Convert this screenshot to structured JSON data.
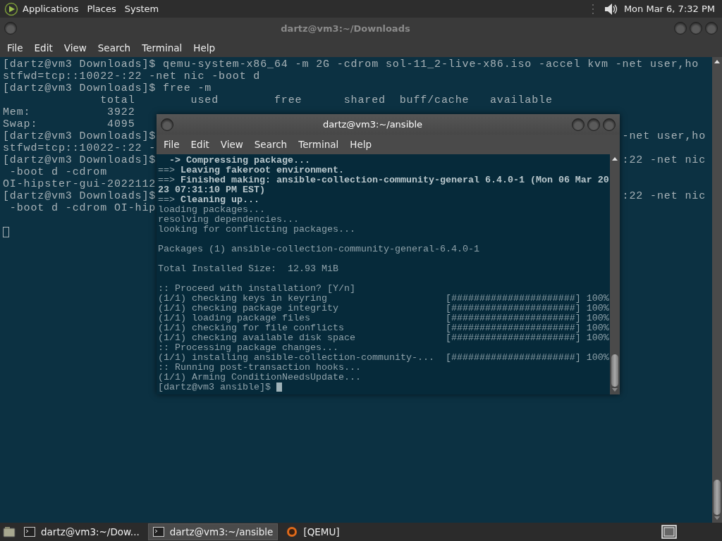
{
  "top_panel": {
    "menus": [
      "Applications",
      "Places",
      "System"
    ],
    "clock": "Mon Mar  6, 7:32 PM"
  },
  "back_window": {
    "title": "dartz@vm3:~/Downloads",
    "menu": [
      "File",
      "Edit",
      "View",
      "Search",
      "Terminal",
      "Help"
    ],
    "lines": [
      {
        "left": "[dartz@vm3 Downloads]$ qemu-system-x86_64 -m 2G -cdrom sol-11_2-live-x86.iso -accel kvm -net user,ho"
      },
      {
        "left": "stfwd=tcp::10022-:22 -net nic -boot d"
      },
      {
        "left": "[dartz@vm3 Downloads]$ free -m"
      },
      {
        "left": "              total        used        free      shared  buff/cache   available"
      },
      {
        "left": "Mem:           3922"
      },
      {
        "left": "Swap:          4095"
      },
      {
        "left": "[dartz@vm3 Downloads]$",
        "right": "-net user,ho"
      },
      {
        "left": "stfwd=tcp::10022-:22 -"
      },
      {
        "left": "[dartz@vm3 Downloads]$",
        "right": ":22 -net nic"
      },
      {
        "left": " -boot d -cdrom"
      },
      {
        "left": "OI-hipster-gui-2022112"
      },
      {
        "left": "[dartz@vm3 Downloads]$",
        "right": ":22 -net nic"
      },
      {
        "left": " -boot d -cdrom OI-hip"
      }
    ],
    "cursor": true
  },
  "front_window": {
    "title": "dartz@vm3:~/ansible",
    "menu": [
      "File",
      "Edit",
      "View",
      "Search",
      "Terminal",
      "Help"
    ],
    "lines": [
      {
        "kind": "bold",
        "text": "  -> Compressing package..."
      },
      {
        "kind": "plain",
        "text": "==> **Leaving fakeroot environment.**"
      },
      {
        "kind": "plain",
        "text": "==> **Finished making: ansible-collection-community-general 6.4.0-1 (Mon 06 Mar 20**"
      },
      {
        "kind": "bold",
        "text": "23 07:31:10 PM EST)"
      },
      {
        "kind": "plain",
        "text": "==> **Cleaning up...**"
      },
      {
        "kind": "plain",
        "text": "loading packages..."
      },
      {
        "kind": "plain",
        "text": "resolving dependencies..."
      },
      {
        "kind": "plain",
        "text": "looking for conflicting packages..."
      },
      {
        "kind": "blank"
      },
      {
        "kind": "plain",
        "text": "Packages (1) ansible-collection-community-general-6.4.0-1"
      },
      {
        "kind": "blank"
      },
      {
        "kind": "plain",
        "text": "Total Installed Size:  12.93 MiB"
      },
      {
        "kind": "blank"
      },
      {
        "kind": "plain",
        "text": ":: Proceed with installation? [Y/n]"
      },
      {
        "kind": "progress",
        "text": "(1/1) checking keys in keyring",
        "bar": "[######################]",
        "percent": "100%"
      },
      {
        "kind": "progress",
        "text": "(1/1) checking package integrity",
        "bar": "[######################]",
        "percent": "100%"
      },
      {
        "kind": "progress",
        "text": "(1/1) loading package files",
        "bar": "[######################]",
        "percent": "100%"
      },
      {
        "kind": "progress",
        "text": "(1/1) checking for file conflicts",
        "bar": "[######################]",
        "percent": "100%"
      },
      {
        "kind": "progress",
        "text": "(1/1) checking available disk space",
        "bar": "[######################]",
        "percent": "100%"
      },
      {
        "kind": "plain",
        "text": ":: Processing package changes..."
      },
      {
        "kind": "progress",
        "text": "(1/1) installing ansible-collection-community-...",
        "bar": "[######################]",
        "percent": "100%"
      },
      {
        "kind": "plain",
        "text": ":: Running post-transaction hooks..."
      },
      {
        "kind": "plain",
        "text": "(1/1) Arming ConditionNeedsUpdate..."
      },
      {
        "kind": "prompt",
        "text": "[dartz@vm3 ansible]$"
      }
    ]
  },
  "taskbar": {
    "tasks": [
      {
        "kind": "terminal",
        "label": "dartz@vm3:~/Dow...",
        "selected": false
      },
      {
        "kind": "terminal",
        "label": "dartz@vm3:~/ansible",
        "selected": true
      },
      {
        "kind": "qemu",
        "label": "[QEMU]",
        "selected": false
      }
    ]
  }
}
